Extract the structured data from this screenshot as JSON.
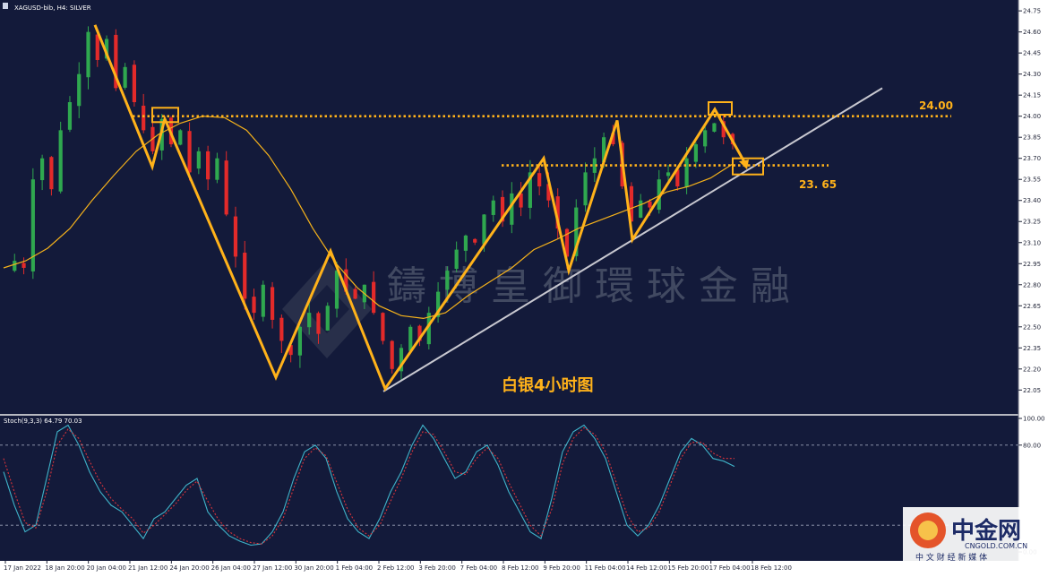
{
  "header": {
    "symbol_line": "XAGUSD-bib, H4: SILVER",
    "stoch_line": "Stoch(9,3,3) 64.79 70.03"
  },
  "annotations": {
    "resistance_label": "24.00",
    "support_label": "23. 65",
    "chart_caption": "白银4小时图",
    "watermark": "鑄 博 皇 御 環 球 金 融"
  },
  "logo": {
    "name": "中金网",
    "url": "CNGOLD.COM.CN",
    "tagline": "中 文 财 经 新 媒 体"
  },
  "colors": {
    "background": "#131a3a",
    "bull_candle": "#2fa84f",
    "bear_candle": "#e32a2a",
    "zigzag": "#ffb21a",
    "ma_line": "#f5b21b",
    "trendline": "#c8c8d0",
    "stoch_main": "#3fb3c9",
    "stoch_signal": "#d9343a",
    "level_dotted": "#ffb21a"
  },
  "chart_data": [
    {
      "type": "candlestick",
      "title": "XAGUSD-bib, H4: SILVER",
      "ylim": [
        21.95,
        24.77
      ],
      "y_ticks": [
        "24.75",
        "24.60",
        "24.45",
        "24.30",
        "24.15",
        "24.00",
        "23.85",
        "23.70",
        "23.55",
        "23.40",
        "23.25",
        "23.10",
        "22.95",
        "22.80",
        "22.65",
        "22.50",
        "22.35",
        "22.20",
        "22.05"
      ],
      "x_ticks": [
        "17 Jan 2022",
        "18 Jan 20:00",
        "20 Jan 04:00",
        "21 Jan 12:00",
        "24 Jan 20:00",
        "26 Jan 04:00",
        "27 Jan 12:00",
        "30 Jan 20:00",
        "1 Feb 04:00",
        "2 Feb 12:00",
        "3 Feb 20:00",
        "7 Feb 04:00",
        "8 Feb 12:00",
        "9 Feb 20:00",
        "11 Feb 04:00",
        "14 Feb 12:00",
        "15 Feb 20:00",
        "17 Feb 04:00",
        "18 Feb 12:00"
      ],
      "levels": [
        {
          "name": "resistance",
          "value": 24.0
        },
        {
          "name": "support",
          "value": 23.65
        }
      ],
      "zigzag_path": [
        24.65,
        23.64,
        23.98,
        22.14,
        23.04,
        22.06,
        23.7,
        22.9,
        23.97,
        23.12,
        24.05,
        23.64
      ],
      "moving_average_path": [
        22.92,
        22.97,
        23.06,
        23.2,
        23.4,
        23.58,
        23.75,
        23.87,
        23.95,
        24.0,
        23.99,
        23.9,
        23.72,
        23.48,
        23.2,
        22.96,
        22.78,
        22.65,
        22.58,
        22.56,
        22.6,
        22.72,
        22.82,
        22.92,
        23.05,
        23.12,
        23.2,
        23.26,
        23.32,
        23.38,
        23.46,
        23.5,
        23.56,
        23.66
      ],
      "trendline": {
        "from": 22.04,
        "to": 24.2
      },
      "ohlc_path": [
        22.9,
        22.97,
        22.92,
        23.55,
        23.7,
        23.48,
        23.9,
        24.1,
        24.3,
        24.6,
        24.4,
        24.55,
        24.2,
        24.35,
        24.1,
        23.9,
        23.75,
        23.98,
        23.8,
        23.9,
        23.6,
        23.75,
        23.55,
        23.7,
        23.3,
        23.0,
        22.7,
        22.6,
        22.8,
        22.55,
        22.4,
        22.3,
        22.5,
        22.6,
        22.45,
        22.65,
        22.9,
        22.75,
        22.7,
        22.8,
        22.6,
        22.4,
        22.2,
        22.35,
        22.5,
        22.4,
        22.6,
        22.75,
        22.9,
        23.05,
        23.15,
        23.1,
        23.3,
        23.4,
        23.25,
        23.45,
        23.35,
        23.6,
        23.5,
        23.4,
        23.2,
        23.0,
        23.35,
        23.6,
        23.7,
        23.85,
        23.8,
        23.5,
        23.25,
        23.4,
        23.35,
        23.55,
        23.6,
        23.5,
        23.7,
        23.8,
        23.9,
        23.95,
        23.85,
        23.8
      ],
      "annotation": "白银4小时图"
    },
    {
      "type": "line",
      "title": "Stoch(9,3,3) 64.79 70.03",
      "ylim": [
        0,
        100
      ],
      "y_ticks": [
        "100.00",
        "80.00",
        "0.00"
      ],
      "levels": [
        80,
        20
      ],
      "series": [
        {
          "name": "64.79",
          "values": [
            60,
            35,
            15,
            20,
            55,
            90,
            95,
            80,
            60,
            45,
            35,
            30,
            20,
            10,
            25,
            30,
            40,
            50,
            55,
            30,
            20,
            12,
            8,
            5,
            6,
            15,
            30,
            55,
            75,
            80,
            70,
            45,
            25,
            15,
            10,
            25,
            45,
            60,
            80,
            95,
            85,
            70,
            55,
            60,
            75,
            80,
            65,
            45,
            30,
            15,
            10,
            40,
            75,
            90,
            95,
            85,
            70,
            45,
            20,
            12,
            20,
            35,
            55,
            75,
            85,
            80,
            70,
            68,
            64
          ]
        },
        {
          "name": "70.03",
          "values": [
            70,
            45,
            22,
            18,
            45,
            80,
            92,
            85,
            68,
            52,
            40,
            32,
            25,
            14,
            20,
            28,
            36,
            46,
            53,
            38,
            24,
            15,
            10,
            7,
            6,
            12,
            25,
            48,
            70,
            78,
            72,
            52,
            32,
            18,
            12,
            20,
            38,
            55,
            75,
            90,
            88,
            75,
            60,
            58,
            70,
            78,
            70,
            52,
            36,
            20,
            12,
            32,
            66,
            85,
            93,
            88,
            75,
            52,
            28,
            15,
            18,
            30,
            50,
            70,
            82,
            82,
            74,
            70,
            70
          ]
        }
      ]
    }
  ]
}
